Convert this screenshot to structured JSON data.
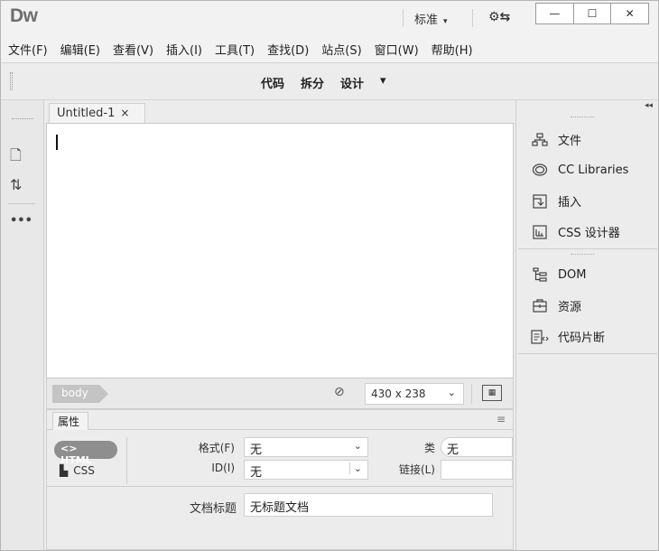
{
  "app": {
    "logo": "Dw"
  },
  "titlebar": {
    "workspace_label": "标准",
    "workspace_caret": "▾",
    "sync_icon": "⚙⇆",
    "minimize": "—",
    "maximize": "☐",
    "close": "✕"
  },
  "menu": [
    {
      "label": "文件(F)"
    },
    {
      "label": "编辑(E)"
    },
    {
      "label": "查看(V)"
    },
    {
      "label": "插入(I)"
    },
    {
      "label": "工具(T)"
    },
    {
      "label": "查找(D)"
    },
    {
      "label": "站点(S)"
    },
    {
      "label": "窗口(W)"
    },
    {
      "label": "帮助(H)"
    }
  ],
  "viewbar": {
    "code": "代码",
    "split": "拆分",
    "design": "设计",
    "caret": "▾"
  },
  "lefttool": {
    "file_icon": "🗋",
    "sort_icon": "⇅",
    "more": "•••"
  },
  "document": {
    "tab_title": "Untitled-1",
    "tab_close": "×"
  },
  "statusbar": {
    "tag": "body",
    "check_icon": "⊘",
    "size_label": "430 x 238",
    "size_caret": "⌄",
    "live_icon": "▦"
  },
  "properties": {
    "tab_label": "属性",
    "menu_icon": "≡",
    "html_btn": "<> HTML",
    "css_btn": "CSS",
    "format_label": "格式(F)",
    "format_value": "无",
    "id_label": "ID(I)",
    "id_value": "无",
    "class_label": "类",
    "class_value": "无",
    "link_label": "链接(L)",
    "link_value": "",
    "title_label": "文档标题",
    "title_value": "无标题文档"
  },
  "rightpanel": {
    "collapse": "◂◂",
    "items": [
      {
        "label": "文件",
        "icon": "files-icon"
      },
      {
        "label": "CC Libraries",
        "icon": "cc-libraries-icon"
      },
      {
        "label": "插入",
        "icon": "insert-icon"
      },
      {
        "label": "CSS 设计器",
        "icon": "css-designer-icon"
      },
      {
        "label": "DOM",
        "icon": "dom-icon"
      },
      {
        "label": "资源",
        "icon": "assets-icon"
      },
      {
        "label": "代码片断",
        "icon": "snippets-icon"
      }
    ]
  }
}
